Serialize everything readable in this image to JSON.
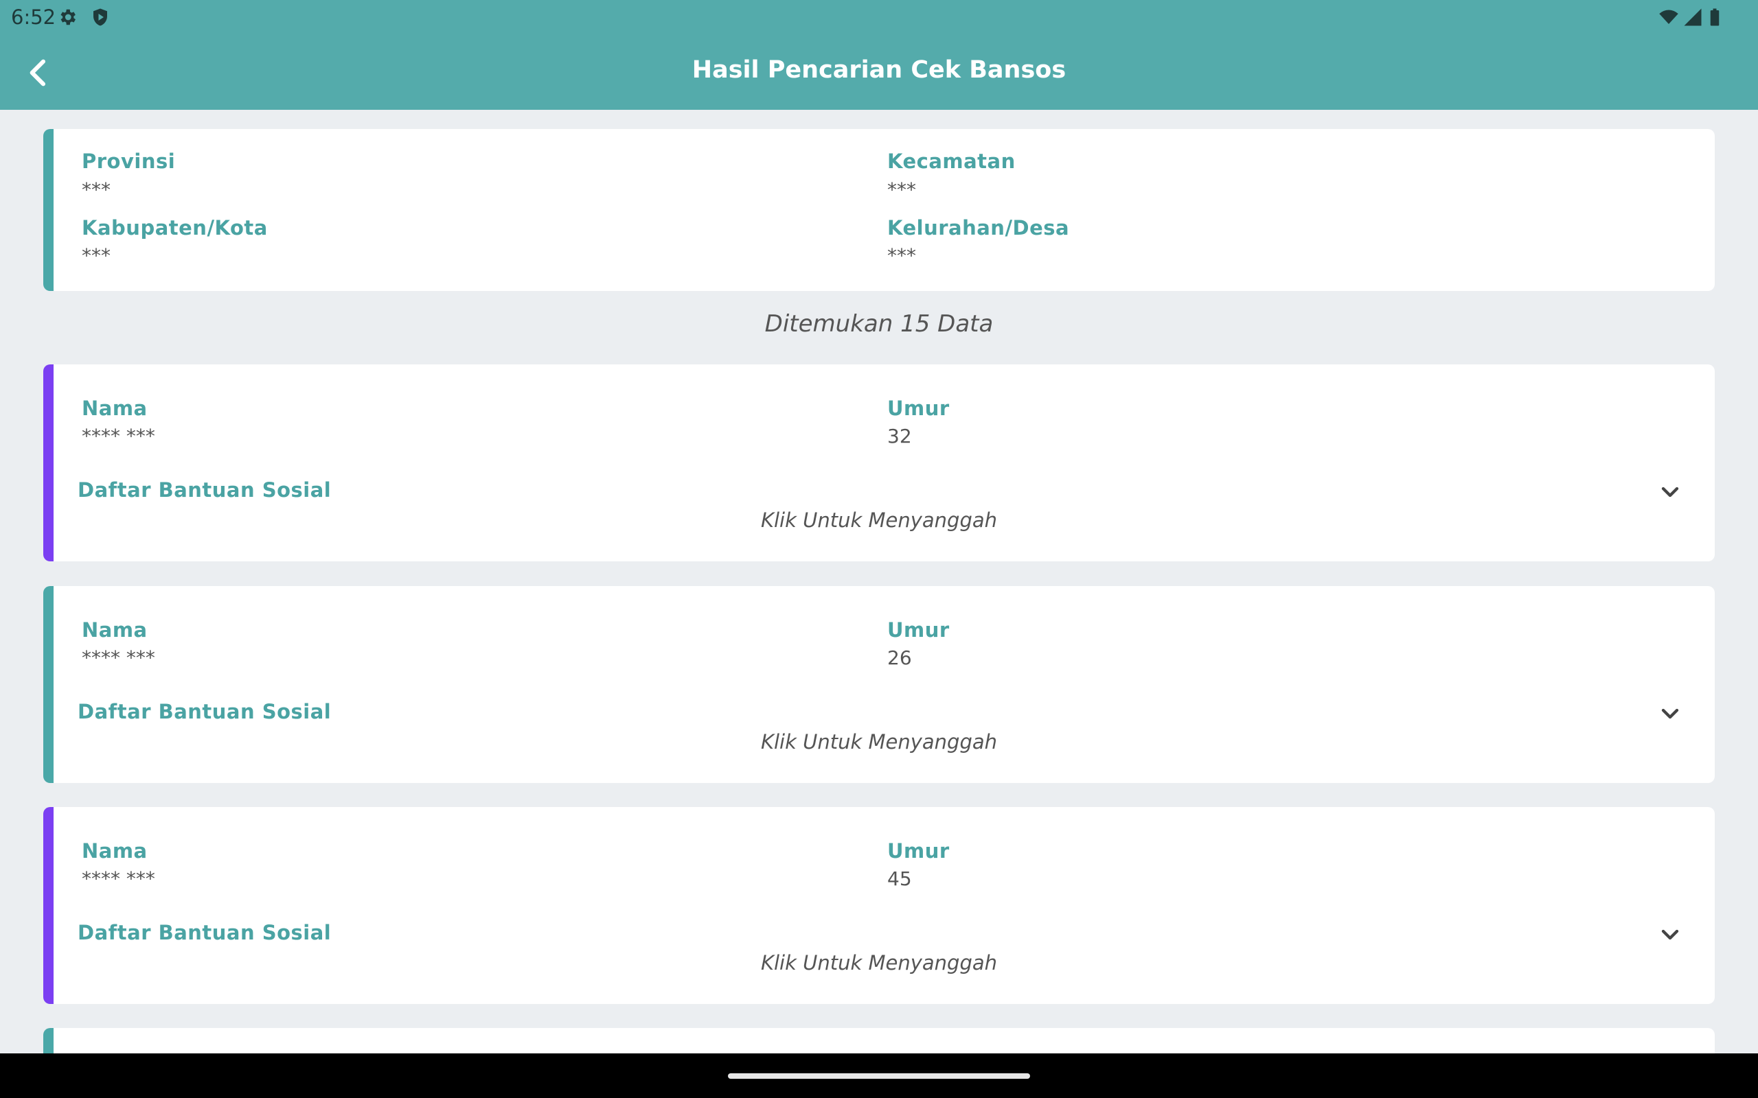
{
  "status_bar": {
    "time": "6:52",
    "left_icons": [
      "gear-icon",
      "shield-play-icon"
    ],
    "right_icons": [
      "wifi-icon",
      "signal-icon",
      "battery-icon"
    ]
  },
  "app_bar": {
    "title": "Hasil Pencarian Cek Bansos",
    "back_icon": "chevron-left-icon"
  },
  "location": {
    "provinsi_label": "Provinsi",
    "provinsi_value": "***",
    "kabupaten_label": "Kabupaten/Kota",
    "kabupaten_value": "***",
    "kecamatan_label": "Kecamatan",
    "kecamatan_value": "***",
    "kelurahan_label": "Kelurahan/Desa",
    "kelurahan_value": "***"
  },
  "found_text": "Ditemukan 15 Data",
  "colors": {
    "primary": "#54abab",
    "accent_purple": "#7b3ff2",
    "accent_teal": "#4aa8a8"
  },
  "results": [
    {
      "nama_label": "Nama",
      "nama_value": "**** ***",
      "umur_label": "Umur",
      "umur_value": "32",
      "list_label": "Daftar Bantuan Sosial",
      "action_text": "Klik Untuk Menyanggah",
      "accent": "#7b3ff2"
    },
    {
      "nama_label": "Nama",
      "nama_value": "**** ***",
      "umur_label": "Umur",
      "umur_value": "26",
      "list_label": "Daftar Bantuan Sosial",
      "action_text": "Klik Untuk Menyanggah",
      "accent": "#4aa8a8"
    },
    {
      "nama_label": "Nama",
      "nama_value": "**** ***",
      "umur_label": "Umur",
      "umur_value": "45",
      "list_label": "Daftar Bantuan Sosial",
      "action_text": "Klik Untuk Menyanggah",
      "accent": "#7b3ff2"
    }
  ]
}
